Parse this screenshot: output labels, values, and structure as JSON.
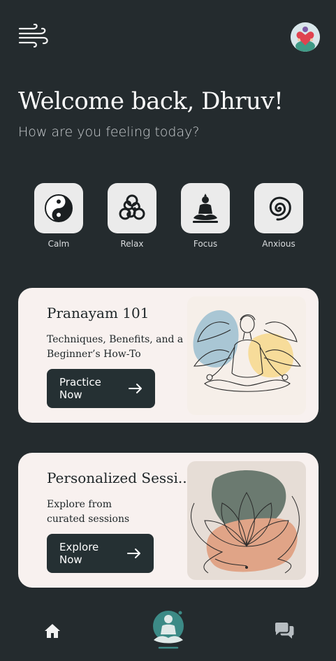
{
  "header": {
    "menu_icon": "wind-menu-icon",
    "avatar_icon": "heart-avatar-icon"
  },
  "greeting": {
    "title": "Welcome back, Dhruv!",
    "subtitle": "How are you feeling today?"
  },
  "moods": [
    {
      "label": "Calm",
      "icon": "yin-yang-icon"
    },
    {
      "label": "Relax",
      "icon": "triskele-icon"
    },
    {
      "label": "Focus",
      "icon": "meditating-buddha-icon"
    },
    {
      "label": "Anxious",
      "icon": "spiral-icon"
    }
  ],
  "cards": [
    {
      "title": "Pranayam 101",
      "description_line1": "Techniques, Benefits, and a",
      "description_line2": "Beginner’s How-To",
      "cta": "Practice Now",
      "art": "meditating-person-illustration"
    },
    {
      "title": "Personalized Sessi...",
      "description_line1": "Explore from",
      "description_line2": "curated sessions",
      "cta": "Explore Now",
      "art": "lotus-illustration"
    }
  ],
  "bottom_nav": [
    {
      "name": "home",
      "icon": "home-icon"
    },
    {
      "name": "meditate",
      "icon": "meditation-icon"
    },
    {
      "name": "chat",
      "icon": "chat-bubbles-icon"
    }
  ],
  "colors": {
    "background": "#242b2e",
    "card": "#f8f1ef",
    "button": "#253033",
    "accent_teal": "#3c8a86"
  }
}
